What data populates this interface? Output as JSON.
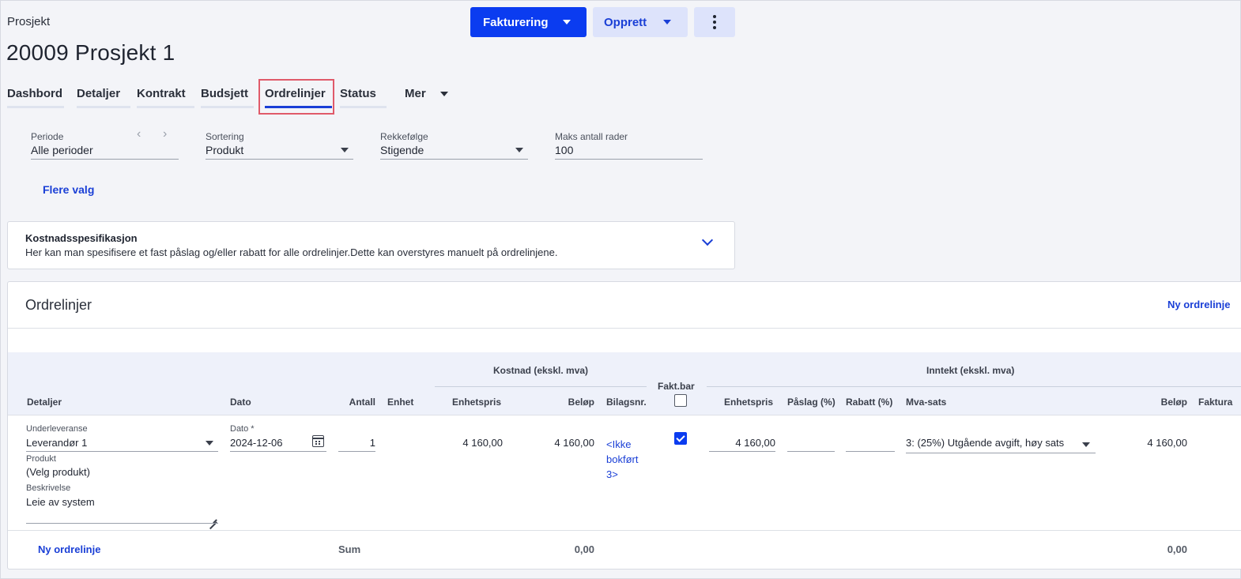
{
  "header": {
    "breadcrumb": "Prosjekt",
    "title": "20009 Prosjekt 1",
    "buttons": {
      "invoicing": "Fakturering",
      "create": "Opprett"
    }
  },
  "tabs": [
    {
      "label": "Dashbord"
    },
    {
      "label": "Detaljer"
    },
    {
      "label": "Kontrakt"
    },
    {
      "label": "Budsjett"
    },
    {
      "label": "Ordrelinjer",
      "active": true
    },
    {
      "label": "Status"
    },
    {
      "label": "Mer"
    }
  ],
  "filters": {
    "period": {
      "label": "Periode",
      "value": "Alle perioder"
    },
    "sorting": {
      "label": "Sortering",
      "value": "Produkt"
    },
    "order": {
      "label": "Rekkefølge",
      "value": "Stigende"
    },
    "max_rows": {
      "label": "Maks antall rader",
      "value": "100"
    },
    "more_options": "Flere valg"
  },
  "cost_spec": {
    "title": "Kostnadsspesifikasjon",
    "description": "Her kan man spesifisere et fast påslag og/eller rabatt for alle ordrelinjer.Dette kan overstyres manuelt på ordrelinjene."
  },
  "orderlines": {
    "title": "Ordrelinjer",
    "new_line_top": "Ny ordrelinje",
    "new_line_bottom": "Ny ordrelinje",
    "group_cost": "Kostnad (ekskl. mva)",
    "group_income": "Inntekt (ekskl. mva)",
    "columns": {
      "details": "Detaljer",
      "date": "Dato",
      "quantity": "Antall",
      "unit": "Enhet",
      "cost_unit_price": "Enhetspris",
      "cost_amount": "Beløp",
      "voucher_no": "Bilagsnr.",
      "billable": "Fakt.bar",
      "income_unit_price": "Enhetspris",
      "markup": "Påslag (%)",
      "discount": "Rabatt (%)",
      "vat_rate": "Mva-sats",
      "income_amount": "Beløp",
      "invoice": "Faktura"
    },
    "row": {
      "sub_delivery_label": "Underleveranse",
      "sub_delivery_value": "Leverandør 1",
      "product_label": "Produkt",
      "product_value": "(Velg produkt)",
      "description_label": "Beskrivelse",
      "description_value": "Leie av system",
      "date_label": "Dato *",
      "date_value": "2024-12-06",
      "quantity": "1",
      "cost_unit_price": "4 160,00",
      "cost_amount": "4 160,00",
      "voucher_line1": "<Ikke",
      "voucher_line2": "bokført",
      "voucher_line3": "3>",
      "billable": true,
      "income_unit_price": "4 160,00",
      "markup": "",
      "discount": "",
      "vat_rate": "3: (25%) Utgående avgift, høy sats",
      "income_amount": "4 160,00"
    },
    "footer": {
      "sum_label": "Sum",
      "cost_sum": "0,00",
      "income_sum": "0,00"
    }
  }
}
